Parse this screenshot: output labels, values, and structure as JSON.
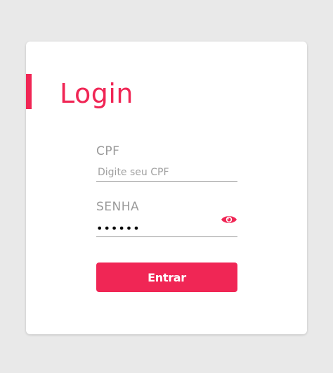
{
  "colors": {
    "accent": "#f02655",
    "background": "#e9e9e9",
    "card": "#ffffff",
    "label": "#9a9a9a"
  },
  "login": {
    "title": "Login",
    "cpf": {
      "label": "CPF",
      "placeholder": "Digite seu CPF",
      "value": ""
    },
    "senha": {
      "label": "SENHA",
      "value": "••••••",
      "toggle_icon": "eye-icon"
    },
    "submit_label": "Entrar"
  }
}
